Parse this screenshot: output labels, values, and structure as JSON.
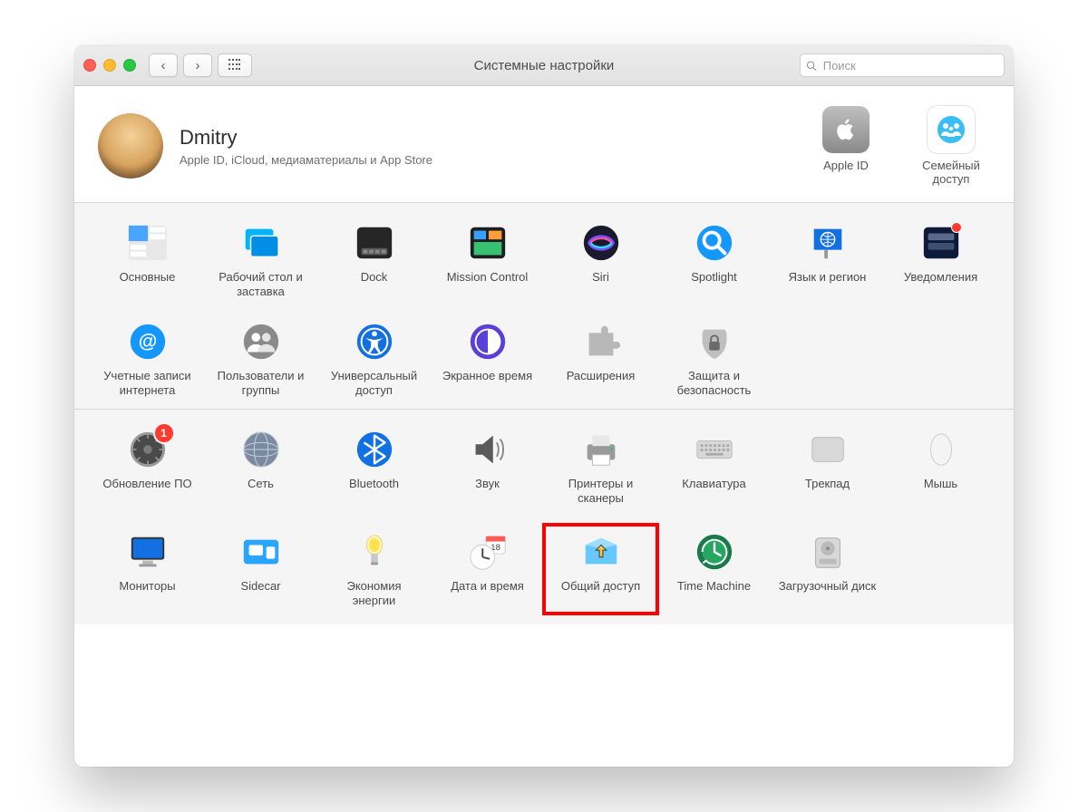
{
  "window": {
    "title": "Системные настройки"
  },
  "search": {
    "placeholder": "Поиск"
  },
  "account": {
    "name": "Dmitry",
    "subtitle": "Apple ID, iCloud, медиаматериалы и App Store",
    "right": [
      {
        "label": "Apple ID",
        "icon": "apple-id-icon"
      },
      {
        "label": "Семейный доступ",
        "icon": "family-sharing-icon"
      }
    ]
  },
  "row1": [
    {
      "label": "Основные",
      "icon": "general-icon"
    },
    {
      "label": "Рабочий стол и заставка",
      "icon": "desktop-icon"
    },
    {
      "label": "Dock",
      "icon": "dock-icon"
    },
    {
      "label": "Mission Control",
      "icon": "mission-control-icon"
    },
    {
      "label": "Siri",
      "icon": "siri-icon"
    },
    {
      "label": "Spotlight",
      "icon": "spotlight-icon"
    },
    {
      "label": "Язык и регион",
      "icon": "language-icon"
    },
    {
      "label": "Уведомления",
      "icon": "notifications-icon",
      "dot": true
    }
  ],
  "row2": [
    {
      "label": "Учетные записи интернета",
      "icon": "internet-accounts-icon"
    },
    {
      "label": "Пользователи и группы",
      "icon": "users-groups-icon"
    },
    {
      "label": "Универсальный доступ",
      "icon": "accessibility-icon"
    },
    {
      "label": "Экранное время",
      "icon": "screen-time-icon"
    },
    {
      "label": "Расширения",
      "icon": "extensions-icon"
    },
    {
      "label": "Защита и безопасность",
      "icon": "security-icon"
    }
  ],
  "row3": [
    {
      "label": "Обновление ПО",
      "icon": "software-update-icon",
      "badge": "1"
    },
    {
      "label": "Сеть",
      "icon": "network-icon"
    },
    {
      "label": "Bluetooth",
      "icon": "bluetooth-icon"
    },
    {
      "label": "Звук",
      "icon": "sound-icon"
    },
    {
      "label": "Принтеры и сканеры",
      "icon": "printers-icon"
    },
    {
      "label": "Клавиатура",
      "icon": "keyboard-icon"
    },
    {
      "label": "Трекпад",
      "icon": "trackpad-icon"
    },
    {
      "label": "Мышь",
      "icon": "mouse-icon"
    }
  ],
  "row4": [
    {
      "label": "Мониторы",
      "icon": "displays-icon"
    },
    {
      "label": "Sidecar",
      "icon": "sidecar-icon"
    },
    {
      "label": "Экономия энергии",
      "icon": "energy-icon"
    },
    {
      "label": "Дата и время",
      "icon": "date-time-icon"
    },
    {
      "label": "Общий доступ",
      "icon": "sharing-icon",
      "highlight": true
    },
    {
      "label": "Time Machine",
      "icon": "time-machine-icon"
    },
    {
      "label": "Загрузочный диск",
      "icon": "startup-disk-icon"
    }
  ]
}
